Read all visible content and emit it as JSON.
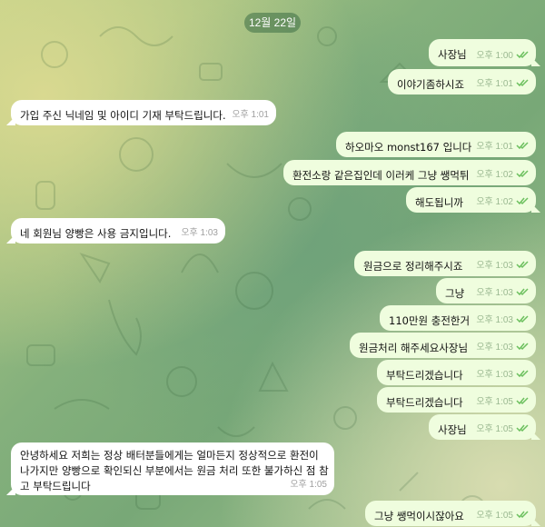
{
  "date_label": "12월 22일",
  "messages": [
    {
      "text": "사장님",
      "time": "오후 1:00"
    },
    {
      "text": "이야기좀하시죠",
      "time": "오후 1:01"
    },
    {
      "text": "가입 주신 닉네임 및 아이디 기재 부탁드립니다.",
      "time": "오후 1:01"
    },
    {
      "text": "하오마오 monst167 입니다",
      "time": "오후 1:01"
    },
    {
      "text": "환전소랑 같은집인데 이러케 그냥 쌩먹튀",
      "time": "오후 1:02"
    },
    {
      "text": "해도됩니까",
      "time": "오후 1:02"
    },
    {
      "text": "네 회원님 양빵은 사용 금지입니다.",
      "time": "오후 1:03"
    },
    {
      "text": "원금으로 정리해주시죠",
      "time": "오후 1:03"
    },
    {
      "text": "그냥",
      "time": "오후 1:03"
    },
    {
      "text": "110만원 충전한거",
      "time": "오후 1:03"
    },
    {
      "text": "원금처리 해주세요사장님",
      "time": "오후 1:03"
    },
    {
      "text": "부탁드리겠습니다",
      "time": "오후 1:03"
    },
    {
      "text": "부탁드리겠습니다",
      "time": "오후 1:05"
    },
    {
      "text": "사장님",
      "time": "오후 1:05"
    },
    {
      "text": "안녕하세요 저희는 정상 배터분들에게는 얼마든지 정상적으로 환전이 나가지만 양빵으로 확인되신 부분에서는 원금 처리 또한 불가하신 점 참고 부탁드립니다",
      "time": "오후 1:05"
    },
    {
      "text": "그냥 쌩먹이시잖아요",
      "time": "오후 1:05"
    }
  ],
  "colors": {
    "outgoing_bubble": "#effdde",
    "incoming_bubble": "#ffffff",
    "read_check": "#6cc05e"
  },
  "icons": {
    "read_receipt": "double-check-icon"
  }
}
